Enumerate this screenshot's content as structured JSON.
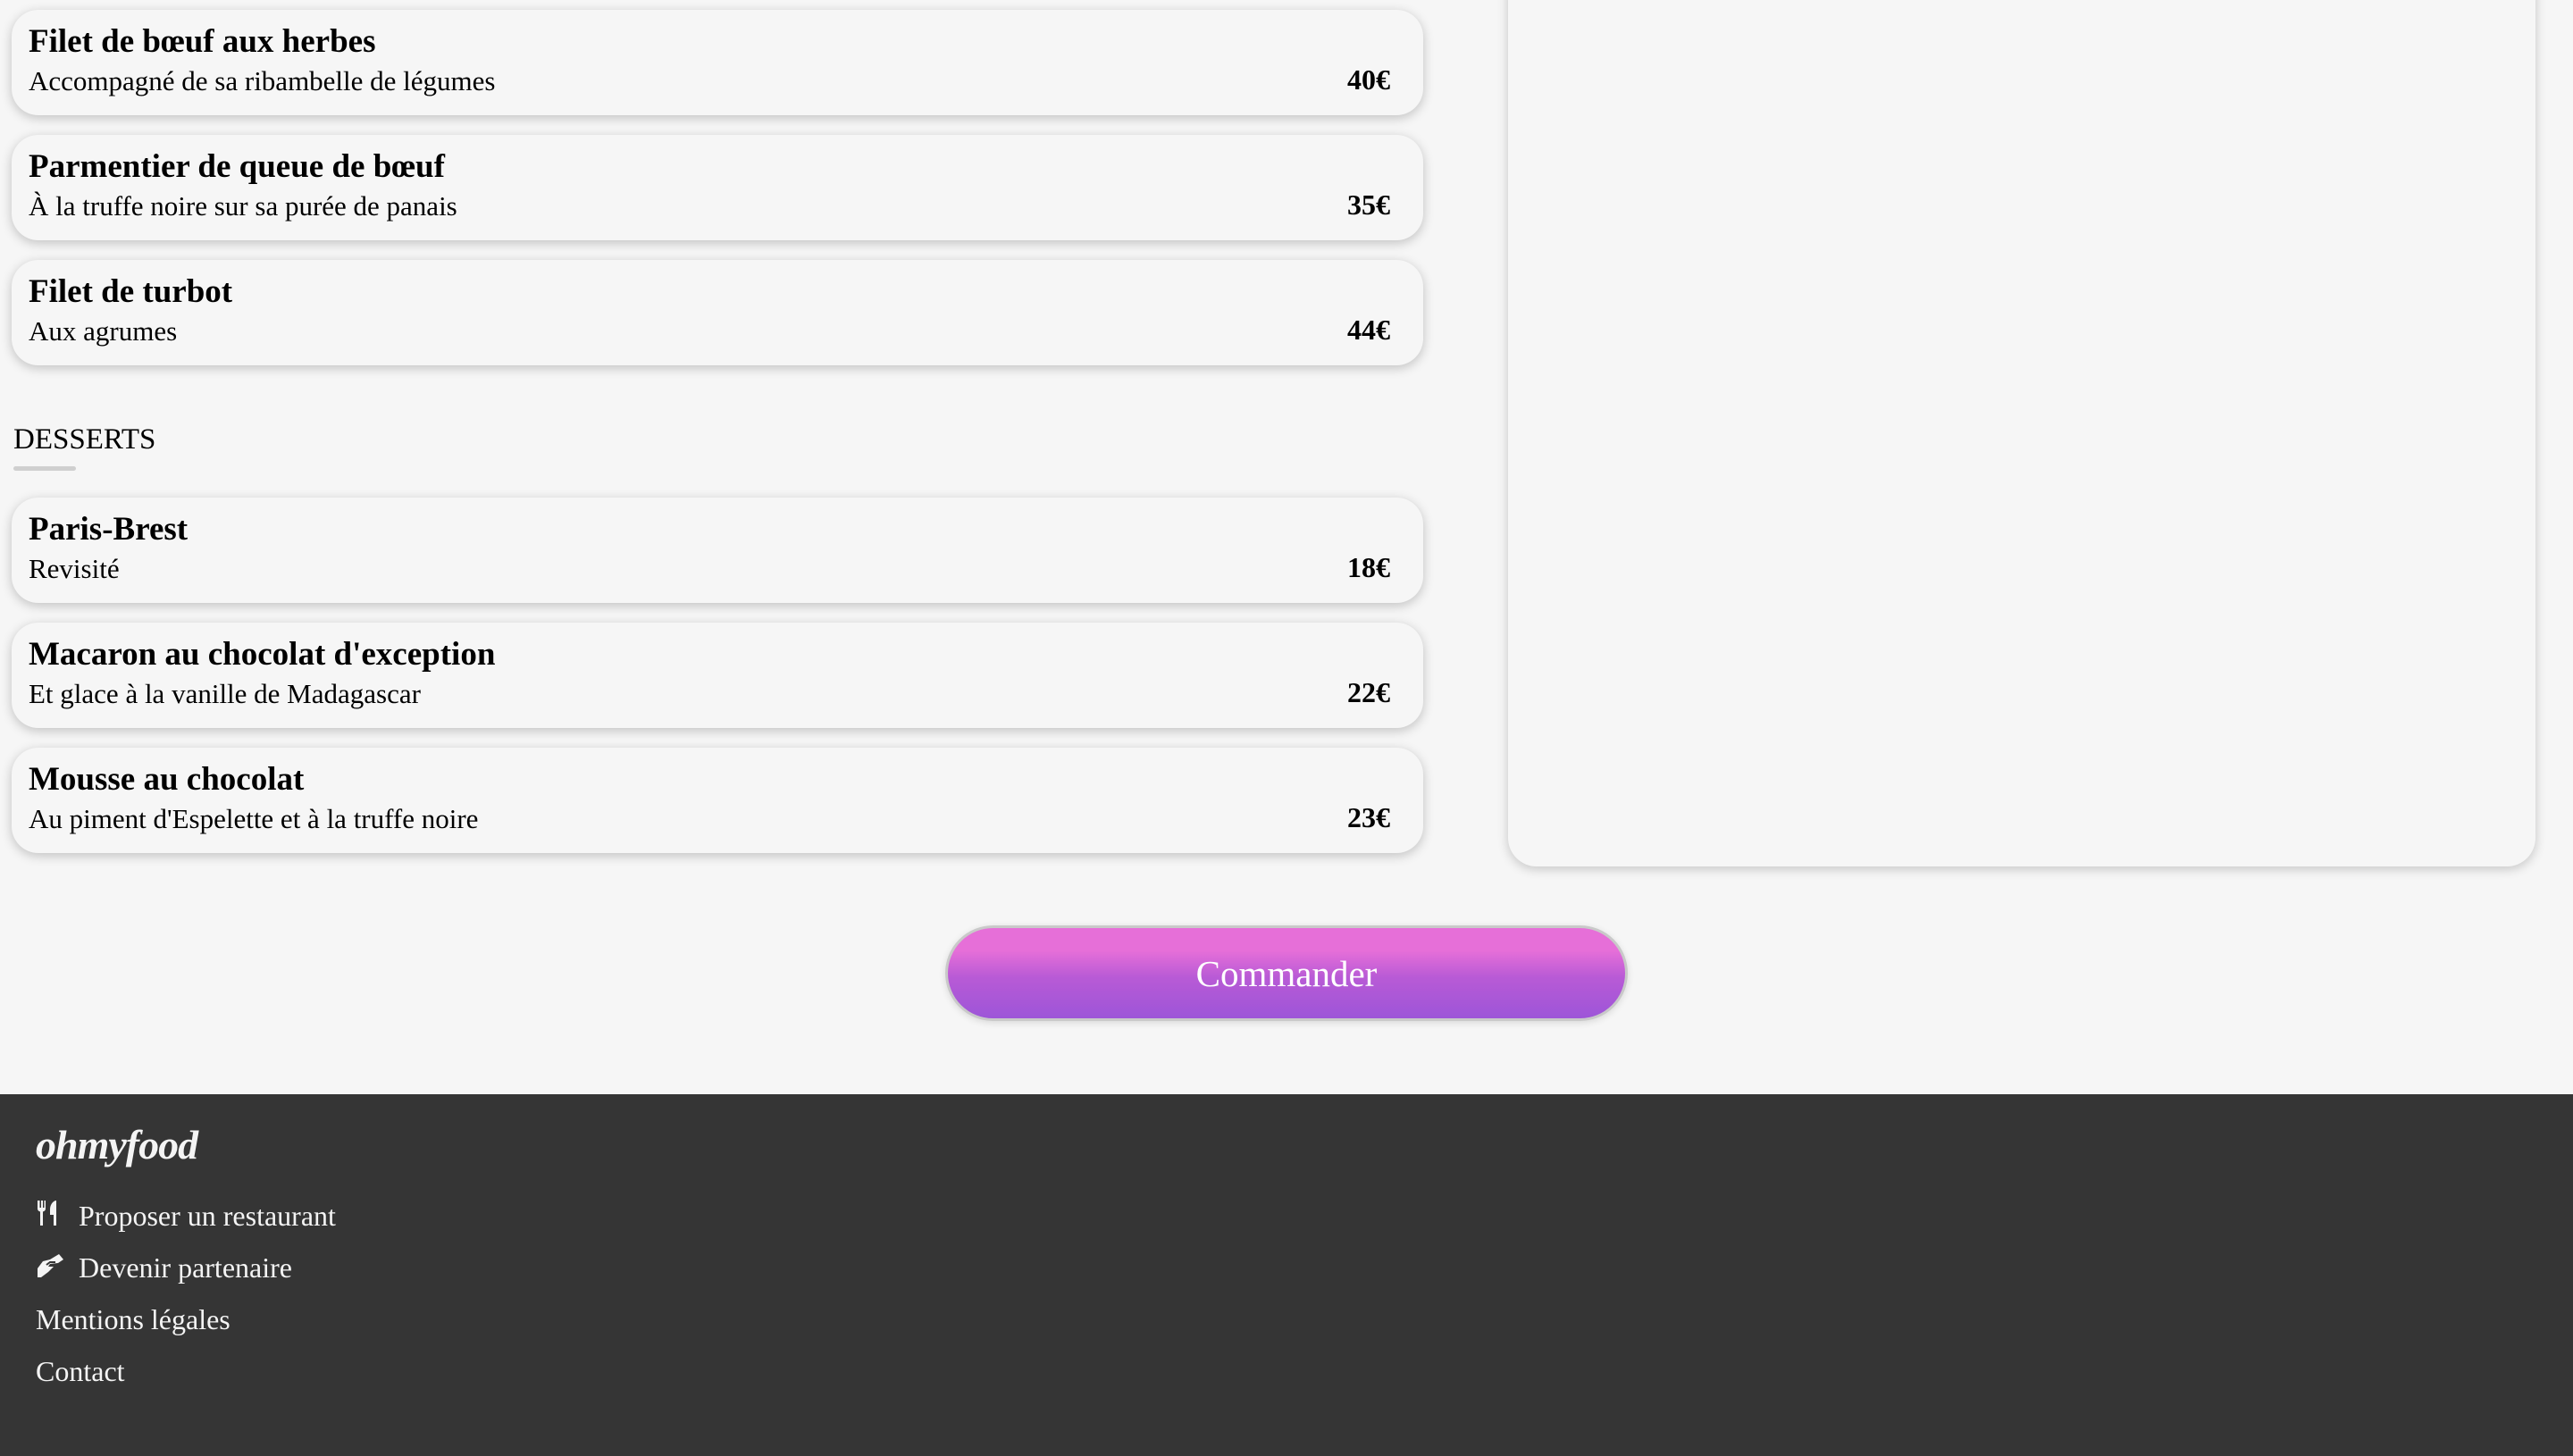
{
  "mains": [
    {
      "title": "Filet de bœuf aux herbes",
      "desc": "Accompagné de sa ribambelle de légumes",
      "price": "40€"
    },
    {
      "title": "Parmentier de queue de bœuf",
      "desc": "À la truffe noire sur sa purée de panais",
      "price": "35€"
    },
    {
      "title": "Filet de turbot",
      "desc": "Aux agrumes",
      "price": "44€"
    }
  ],
  "desserts_title": "DESSERTS",
  "desserts": [
    {
      "title": "Paris-Brest",
      "desc": "Revisité",
      "price": "18€"
    },
    {
      "title": "Macaron au chocolat d'exception",
      "desc": "Et glace à la vanille de Madagascar",
      "price": "22€"
    },
    {
      "title": "Mousse au chocolat",
      "desc": "Au piment d'Espelette et à la truffe noire",
      "price": "23€"
    }
  ],
  "order_button": "Commander",
  "footer": {
    "logo": "ohmyfood",
    "links": [
      {
        "label": "Proposer un restaurant",
        "icon": "utensils-icon"
      },
      {
        "label": "Devenir partenaire",
        "icon": "handshake-icon"
      },
      {
        "label": "Mentions légales"
      },
      {
        "label": "Contact"
      }
    ]
  },
  "colors": {
    "gradient_top": "#e66fd8",
    "gradient_bottom": "#9d55d8",
    "footer_bg": "#353535"
  }
}
